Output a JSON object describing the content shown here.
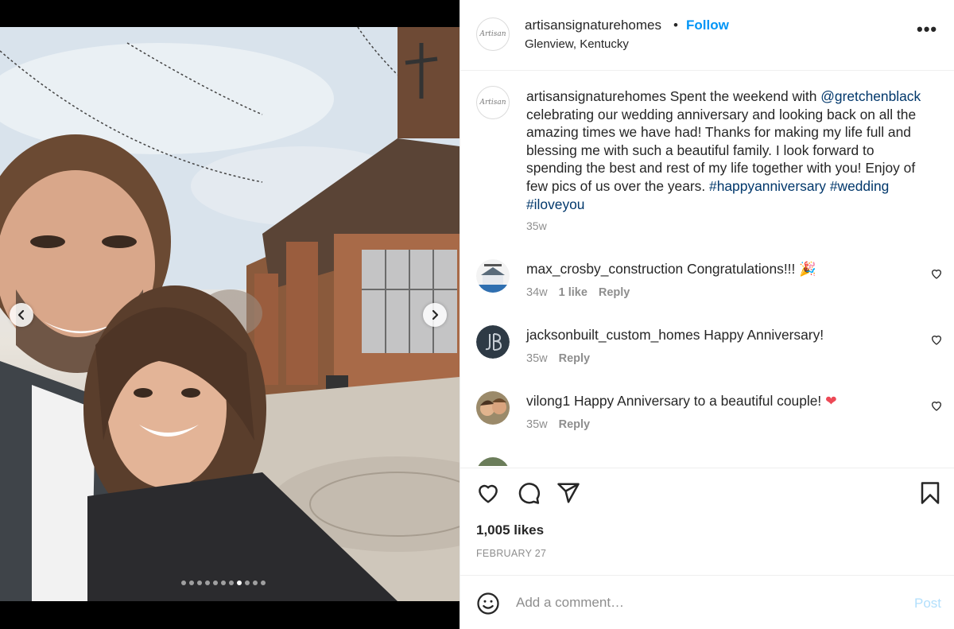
{
  "post": {
    "username": "artisansignaturehomes",
    "bullet": "•",
    "follow_label": "Follow",
    "location": "Glenview, Kentucky",
    "avatar_text": "Artisan",
    "more_label": "•••"
  },
  "media": {
    "slide_count": 11,
    "active_slide": 8
  },
  "caption": {
    "username": "artisansignaturehomes",
    "text_part1": " Spent the weekend with ",
    "mention": "@gretchenblack",
    "text_part2": " celebrating our wedding anniversary and looking back on all the amazing times we have had! Thanks for making my life full and blessing me with such a beautiful family. I look forward to spending the best and rest of my life together with you! Enjoy of few pics of us over the years. ",
    "tag1": "#happyanniversary",
    "tag2": "#wedding",
    "tag3": "#iloveyou",
    "time": "35w"
  },
  "comments": [
    {
      "username": "max_crosby_construction",
      "text": " Congratulations!!! 🎉",
      "time": "34w",
      "likes": "1 like",
      "reply": "Reply"
    },
    {
      "username": "jacksonbuilt_custom_homes",
      "text": " Happy Anniversary!",
      "time": "35w",
      "likes": "",
      "reply": "Reply"
    },
    {
      "username": "vilong1",
      "text": " Happy Anniversary to a beautiful couple! ❤",
      "time": "35w",
      "likes": "",
      "reply": "Reply"
    }
  ],
  "stats": {
    "likes": "1,005 likes",
    "date": "FEBRUARY 27"
  },
  "composer": {
    "placeholder": "Add a comment…",
    "post_label": "Post"
  },
  "colors": {
    "accent": "#0095f6",
    "link": "#00376b",
    "muted": "#8e8e8e",
    "post_disabled": "#b2dffc",
    "heart_red": "#ed4956"
  }
}
